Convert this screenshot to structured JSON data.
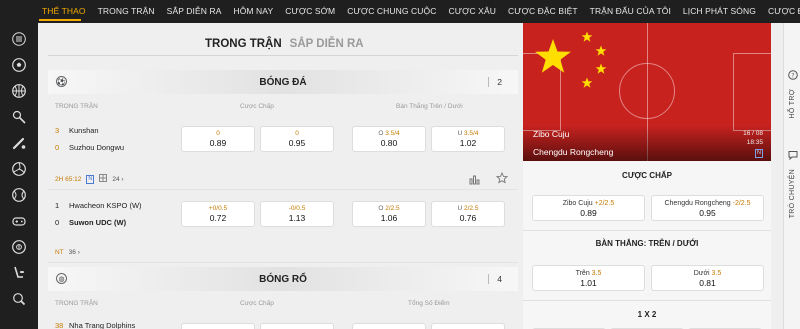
{
  "nav": {
    "items": [
      "THỂ THAO",
      "TRONG TRẬN",
      "SẮP DIỄN RA",
      "HÔM NAY",
      "CƯỢC SỚM",
      "CƯỢC CHUNG CUỘC",
      "CƯỢC XÂU",
      "CƯỢC ĐẶC BIỆT",
      "TRẬN ĐẤU CỦA TÔI",
      "LỊCH PHÁT SÓNG",
      "CƯỢC ĐÃ ĐẶT"
    ]
  },
  "tabs": {
    "live": "TRONG TRẬN",
    "upcoming": "SẮP DIỄN RA"
  },
  "football": {
    "title": "BÓNG ĐÁ",
    "count": "2",
    "col_live": "TRONG TRẬN",
    "col_handicap": "Cược Chấp",
    "col_ou": "Bàn Thắng Trên / Dưới",
    "matches": [
      {
        "home": {
          "score": "3",
          "name": "Kunshan"
        },
        "away": {
          "score": "0",
          "name": "Suzhou Dongwu"
        },
        "hdp_home": {
          "line": "0",
          "odd": "0.89"
        },
        "hdp_away": {
          "line": "0",
          "odd": "0.95"
        },
        "ou_over": {
          "label": "O",
          "line": "3.5/4",
          "odd": "0.80"
        },
        "ou_under": {
          "label": "U",
          "line": "3.5/4",
          "odd": "1.02"
        },
        "time": "2H 65:12",
        "n": "N",
        "markets": "24"
      },
      {
        "home": {
          "score": "1",
          "name": "Hwacheon KSPO (W)"
        },
        "away": {
          "score": "0",
          "name": "Suwon UDC (W)"
        },
        "hdp_home": {
          "line": "+0/0.5",
          "odd": "0.72"
        },
        "hdp_away": {
          "line": "-0/0.5",
          "odd": "1.13"
        },
        "ou_over": {
          "label": "O",
          "line": "2/2.5",
          "odd": "1.06"
        },
        "ou_under": {
          "label": "U",
          "line": "2/2.5",
          "odd": "0.76"
        },
        "time": "NT",
        "markets": "36"
      }
    ]
  },
  "basketball": {
    "title": "BÓNG RỔ",
    "count": "4",
    "col_live": "TRONG TRẬN",
    "col_handicap": "Cược Chấp",
    "col_total": "Tổng Số Điểm",
    "first_home": {
      "score": "38",
      "name": "Nha Trang Dolphins"
    }
  },
  "panel": {
    "home": "Zibo Cuju",
    "away": "Chengdu Rongcheng",
    "date": "16 / 08",
    "time": "18:35",
    "n": "N",
    "handicap_title": "CƯỢC CHẤP",
    "hdp_home": {
      "name": "Zibo Cuju",
      "line": "+2/2.5",
      "odd": "0.89"
    },
    "hdp_away": {
      "name": "Chengdu Rongcheng",
      "line": "-2/2.5",
      "odd": "0.95"
    },
    "ou_title": "BÀN THẮNG: TRÊN / DƯỚI",
    "ou_over": {
      "name": "Trên",
      "line": "3.5",
      "odd": "1.01"
    },
    "ou_under": {
      "name": "Dưới",
      "line": "3.5",
      "odd": "0.81"
    },
    "x12_title": "1 X 2"
  },
  "side_tabs": {
    "help": "HỖ TRỢ",
    "chat": "TRÒ CHUYỆN"
  },
  "colors": {
    "accent": "#f2a900",
    "odds_line": "#c47a00",
    "nav_bg": "#1f1f1f",
    "flag_red": "#c8221f",
    "flag_star": "#ffde00"
  },
  "icons": [
    "menu-icon",
    "football-icon",
    "basketball-icon",
    "badminton-icon",
    "baseball-icon",
    "volleyball-icon",
    "tennis-icon",
    "esports-icon",
    "pool-icon",
    "ice-hockey-icon",
    "table-tennis-icon",
    "stats-icon",
    "favorite-star-icon",
    "question-icon",
    "chat-icon"
  ]
}
